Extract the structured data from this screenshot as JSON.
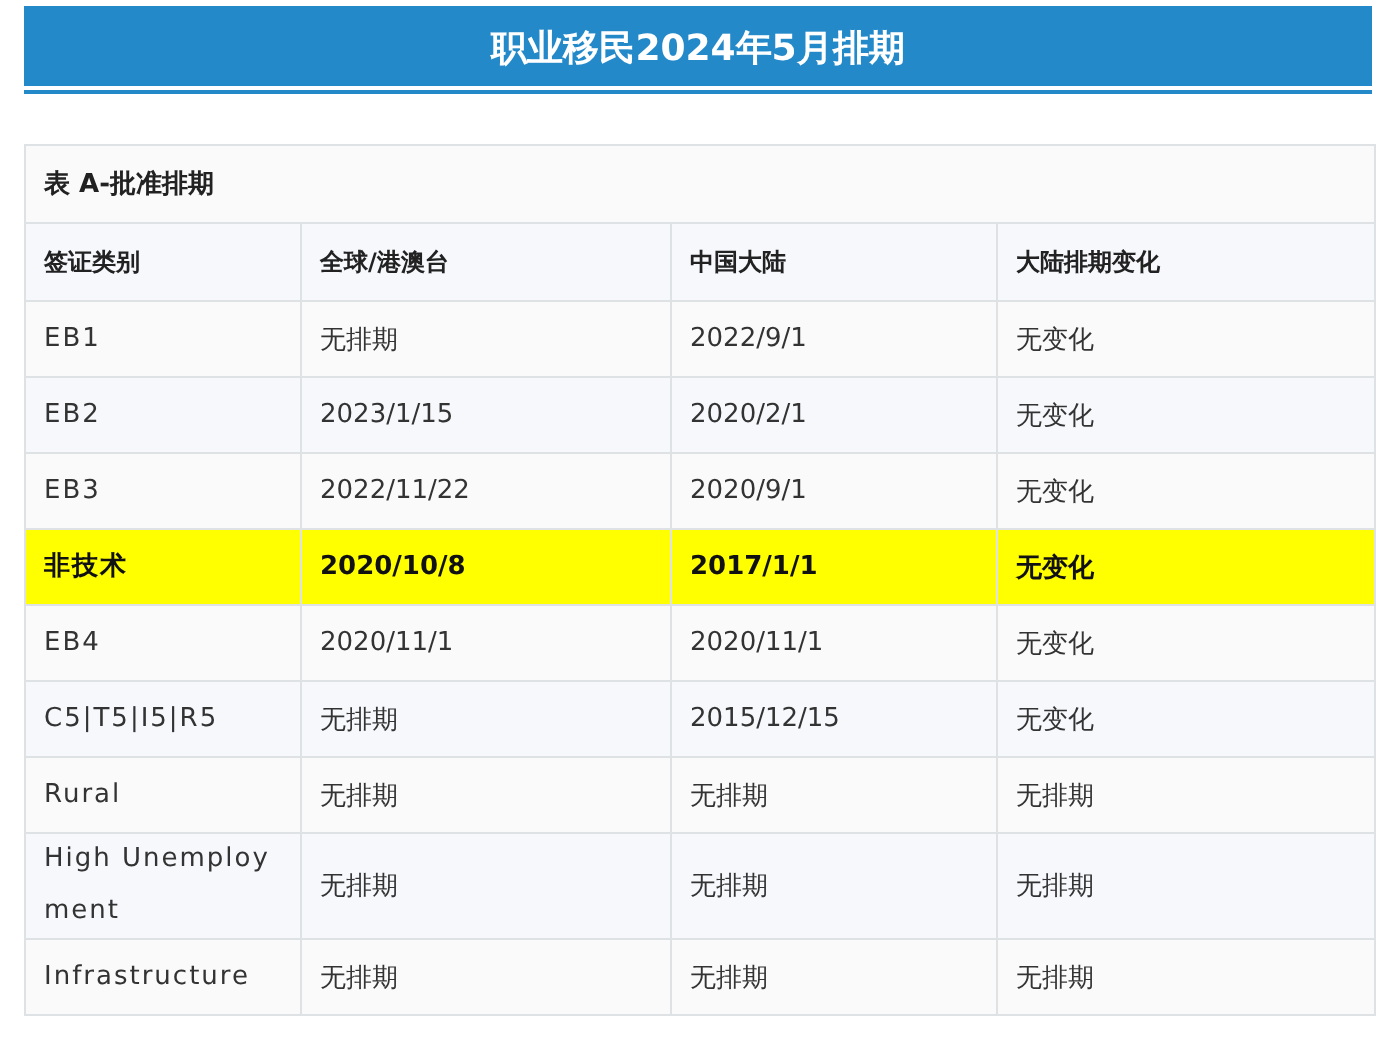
{
  "title": "职业移民2024年5月排期",
  "table": {
    "caption": "表 A-批准排期",
    "columns": [
      "签证类别",
      "全球/港澳台",
      "中国大陆",
      "大陆排期变化"
    ],
    "rows": [
      {
        "cells": [
          "EB1",
          "无排期",
          "2022/9/1",
          "无变化"
        ],
        "highlighted": false
      },
      {
        "cells": [
          "EB2",
          "2023/1/15",
          "2020/2/1",
          "无变化"
        ],
        "highlighted": false
      },
      {
        "cells": [
          "EB3",
          "2022/11/22",
          "2020/9/1",
          "无变化"
        ],
        "highlighted": false
      },
      {
        "cells": [
          "非技术",
          "2020/10/8",
          "2017/1/1",
          "无变化"
        ],
        "highlighted": true
      },
      {
        "cells": [
          "EB4",
          "2020/11/1",
          "2020/11/1",
          "无变化"
        ],
        "highlighted": false
      },
      {
        "cells": [
          "C5|T5|I5|R5",
          "无排期",
          "2015/12/15",
          "无变化"
        ],
        "highlighted": false
      },
      {
        "cells": [
          "Rural",
          "无排期",
          "无排期",
          "无排期"
        ],
        "highlighted": false
      },
      {
        "cells": [
          "High Unemployment",
          "无排期",
          "无排期",
          "无排期"
        ],
        "highlighted": false
      },
      {
        "cells": [
          "Infrastructure",
          "无排期",
          "无排期",
          "无排期"
        ],
        "highlighted": false
      }
    ]
  }
}
